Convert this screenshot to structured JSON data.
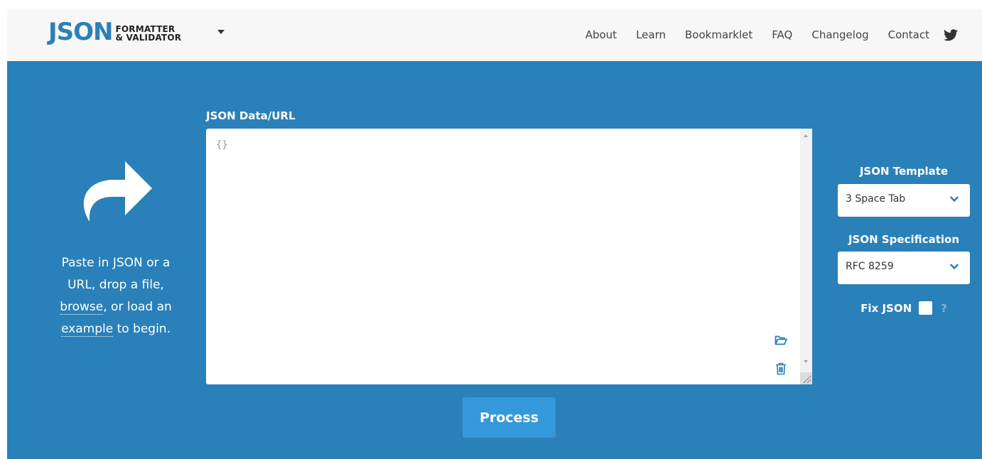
{
  "logo": {
    "main": "JSON",
    "line1": "FORMATTER",
    "line2": "& VALIDATOR"
  },
  "nav": {
    "links": [
      "About",
      "Learn",
      "Bookmarklet",
      "FAQ",
      "Changelog",
      "Contact"
    ],
    "social_icon": "twitter-icon"
  },
  "intro": {
    "line1": "Paste in JSON or a",
    "line2": "URL, drop a file,",
    "browse_link": "browse",
    "line3_rest": ", or load an",
    "example_link": "example",
    "line4_rest": " to begin.",
    "arrow_icon": "share-arrow-icon"
  },
  "editor": {
    "label": "JSON Data/URL",
    "value": "{}",
    "icons": [
      "folder-open-icon",
      "trash-icon"
    ]
  },
  "process_button": "Process",
  "options": {
    "template_label": "JSON Template",
    "template_value": "3 Space Tab",
    "spec_label": "JSON Specification",
    "spec_value": "RFC 8259",
    "fix_label": "Fix JSON",
    "fix_checked": false,
    "help": "?"
  },
  "colors": {
    "background": "#2a80b9",
    "navbar": "#f7f7f7",
    "button": "#3498db",
    "accent": "#2a80b9"
  }
}
